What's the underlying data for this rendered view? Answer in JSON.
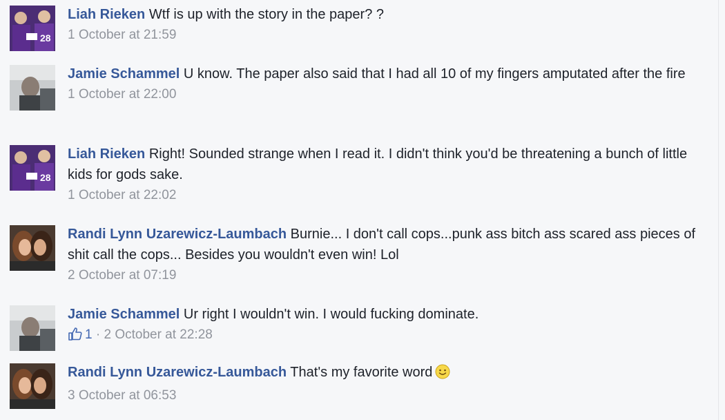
{
  "comments": [
    {
      "author": "Liah Rieken",
      "text": "Wtf is up with the story in the paper? ?",
      "meta": "1 October at 21:59",
      "avatar": "purple-jersey-fans-photo"
    },
    {
      "author": "Jamie Schammel",
      "text": "U know. The paper also said that I had all 10 of my fingers amputated after the fire",
      "meta": "1 October at 22:00",
      "avatar": "car-selfie-photo"
    },
    {
      "author": "Liah Rieken",
      "text": "Right! Sounded strange when I read it. I didn't think you'd be threatening a bunch of little kids for gods sake.",
      "meta": "1 October at 22:02",
      "avatar": "purple-jersey-fans-photo"
    },
    {
      "author": "Randi Lynn Uzarewicz-Laumbach",
      "text": "Burnie... I don't call cops...punk ass bitch ass scared ass pieces of shit call the cops... Besides you wouldn't even win! Lol",
      "meta": "2 October at 07:19",
      "avatar": "two-women-selfie-photo"
    },
    {
      "author": "Jamie Schammel",
      "text": "Ur right I wouldn't win. I would fucking dominate.",
      "likes": "1",
      "separator": " · ",
      "meta": "2 October at 22:28",
      "avatar": "car-selfie-photo"
    },
    {
      "author": "Randi Lynn Uzarewicz-Laumbach",
      "text": "That's my favorite word",
      "emoji": "smiley-emoji",
      "meta": "3 October at 06:53",
      "avatar": "two-women-selfie-photo"
    }
  ],
  "colors": {
    "author": "#365899",
    "text": "#1d2129",
    "meta": "#90949c",
    "background": "#f6f7f9"
  }
}
